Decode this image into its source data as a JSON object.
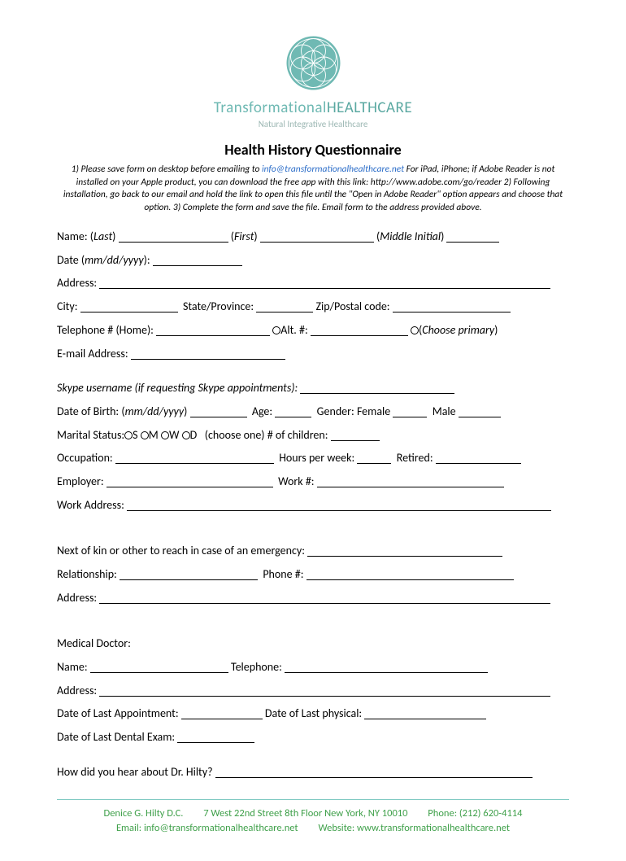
{
  "brand": {
    "line1_light": "Transformational",
    "line1_bold": "HEALTHCARE",
    "line2": "Natural Integrative Healthcare"
  },
  "title": "Health History Questionnaire",
  "instructions": {
    "part1": "1) Please save form on desktop before emailing to ",
    "email": "info@transformationalhealthcare.net",
    "part2": " For iPad, iPhone; if Adobe Reader is not installed on your Apple product, you can download the free app with this link: http://www.adobe.com/go/reader 2) Following installation, go back to our email and hold the link to open this file until the \"Open in Adobe Reader\" option appears and choose that option. 3) Complete the form and save the file. Email form to the address provided above."
  },
  "labels": {
    "name": "Name: (",
    "last": "Last",
    "first_paren": ")",
    "first": "First",
    "mi": "Middle Initial",
    "date": "Date (",
    "mmddyyyy": "mm/dd/yyyy",
    "date_close": "):",
    "address": "Address:",
    "city": "City:",
    "state": "State/Province:",
    "zip": "Zip/Postal code:",
    "tel_home": "Telephone # (Home):",
    "alt": "Alt. #:",
    "choose_primary": "Choose primary",
    "email": "E-mail Address:",
    "skype": "Skype username (if requesting Skype  appointments):",
    "dob": "Date of Birth: (",
    "age": "Age:",
    "gender": "Gender: Female",
    "male": "Male",
    "marital": "Marital Status:",
    "ms_s": "S",
    "ms_m": "M",
    "ms_w": "W",
    "ms_d": "D",
    "choose_one": "(choose one)  # of children:",
    "occupation": "Occupation:",
    "hours": "Hours per week:",
    "retired": "Retired:",
    "employer": "Employer:",
    "workno": "Work #:",
    "workaddr": "Work Address:",
    "nextkin": "Next of kin or other to reach in case of an emergency:",
    "relationship": "Relationship:",
    "phone": "Phone #:",
    "addr2": "Address:",
    "meddoc": "Medical Doctor:",
    "docname": "Name:",
    "doctel": "Telephone:",
    "docaddr": "Address:",
    "lastappt": "Date of Last Appointment:",
    "lastphys": "Date of Last physical:",
    "lastdental": "Date of Last Dental Exam:",
    "hear": "How did you hear about Dr. Hilty?"
  },
  "footer": {
    "name": "Denice G. Hilty D.C.",
    "addr": "7 West 22nd Street 8th Floor New York, NY 10010",
    "phone_lbl": "Phone: ",
    "phone": "(212) 620-4114",
    "email_lbl": "Email: ",
    "email": "info@transformationalhealthcare.net",
    "site_lbl": "Website: ",
    "site": "www.transformationalhealthcare.net"
  }
}
